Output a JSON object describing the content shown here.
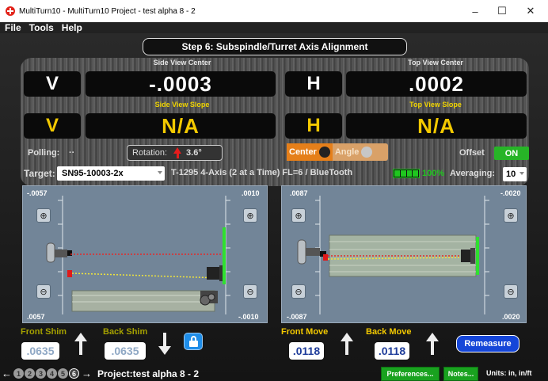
{
  "window": {
    "title": "MultiTurn10 - MultiTurn10 Project - test alpha 8 - 2",
    "controls": [
      "–",
      "☐",
      "✕"
    ]
  },
  "menu": [
    "File",
    "Tools",
    "Help"
  ],
  "step_title": "Step 6: Subspindle/Turret Axis Alignment",
  "readouts": {
    "side_center": {
      "label": "Side View Center",
      "axis": "V",
      "value": "-.0003"
    },
    "top_center": {
      "label": "Top View Center",
      "axis": "H",
      "value": ".0002"
    },
    "side_slope": {
      "label": "Side View Slope",
      "axis": "V",
      "value": "N/A"
    },
    "top_slope": {
      "label": "Top View Slope",
      "axis": "H",
      "value": "N/A"
    }
  },
  "controls": {
    "polling_label": "Polling:",
    "polling_value": "··",
    "rotation_label": "Rotation:",
    "rotation_value": "3.6°",
    "center_label": "Center",
    "angle_label": "Angle",
    "offset_label": "Offset",
    "offset_state": "ON",
    "target_label": "Target:",
    "target_value": "SN95-10003-2x",
    "target_desc": "T-1295 4-Axis (2 at a Time) FL=6 / BlueTooth",
    "battery_percent": "100%",
    "averaging_label": "Averaging:",
    "averaging_value": "10"
  },
  "side_view": {
    "top_left": "-.0057",
    "bottom_left": ".0057",
    "top_right": ".0010",
    "bottom_right": "-.0010"
  },
  "top_view": {
    "top_left": ".0087",
    "bottom_left": "-.0087",
    "top_right": "-.0020",
    "bottom_right": ".0020"
  },
  "shims": {
    "front_label": "Front Shim",
    "front_value": ".0635",
    "back_label": "Back Shim",
    "back_value": ".0635"
  },
  "moves": {
    "front_label": "Front Move",
    "front_value": ".0118",
    "back_label": "Back Move",
    "back_value": ".0118"
  },
  "remeasure_label": "Remeasure",
  "footer": {
    "steps": [
      "1",
      "2",
      "3",
      "4",
      "5",
      "6"
    ],
    "project": "Project:test alpha 8 - 2",
    "preferences": "Preferences...",
    "notes": "Notes...",
    "units": "Units: in, in/ft"
  },
  "colors": {
    "yellow": "#f3c900",
    "on_green": "#27b427",
    "remeasure_blue": "#1546d8",
    "panel": "#728598"
  }
}
